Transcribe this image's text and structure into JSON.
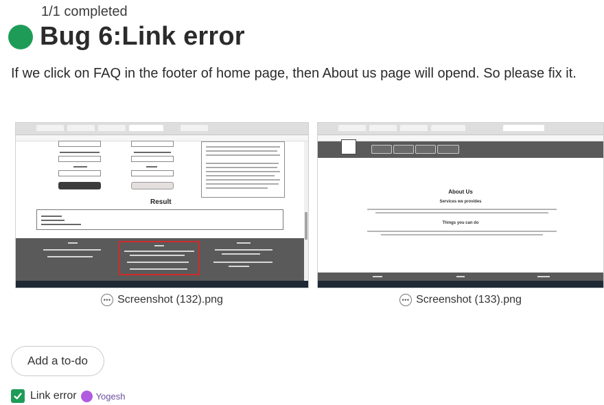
{
  "header": {
    "progress": "1/1 completed",
    "title": "Bug 6:Link error",
    "status_color": "#1e9c57"
  },
  "description": "If we click on FAQ in the footer of home page, then About us page will opend. So please fix it.",
  "attachments": [
    {
      "filename": "Screenshot (132).png",
      "icon": "more-icon"
    },
    {
      "filename": "Screenshot (133).png",
      "icon": "more-icon"
    }
  ],
  "thumb_text": {
    "result": "Result",
    "about": "About Us",
    "services": "Services we provides",
    "things": "Things you can do"
  },
  "actions": {
    "add_todo": "Add a to-do"
  },
  "todo": {
    "label": "Link error",
    "checked": true,
    "assignee": "Yogesh",
    "avatar_color": "#b05be0"
  }
}
